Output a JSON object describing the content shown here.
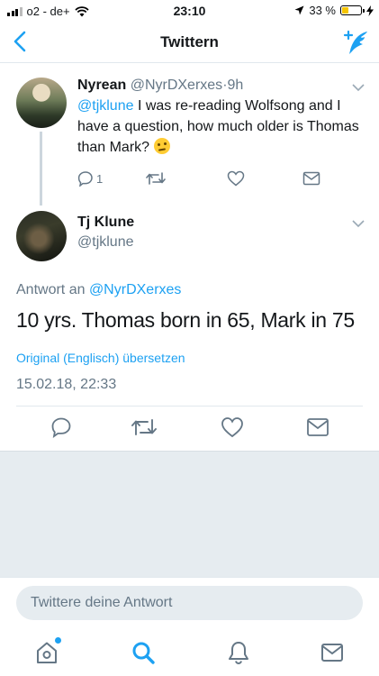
{
  "status_bar": {
    "carrier": "o2 - de+",
    "time": "23:10",
    "battery": "33 %",
    "battery_level": 0.33
  },
  "nav": {
    "title": "Twittern",
    "back_icon": "chevron-left-icon",
    "compose_icon": "compose-tweet-icon"
  },
  "parent_tweet": {
    "name": "Nyrean",
    "handle": "@NyrDXerxes",
    "time": "9h",
    "mention": "@tjklune",
    "text": "I was re-reading Wolfsong and I have a question, how much older is Thomas than Mark?",
    "emoji": "thinking-face-emoji",
    "reply_count": "1"
  },
  "main_tweet": {
    "name": "Tj Klune",
    "handle": "@tjklune",
    "replying_prefix": "Antwort an",
    "replying_to": "@NyrDXerxes",
    "text": "10 yrs. Thomas born in 65, Mark in 75",
    "translate": "Original (Englisch) übersetzen",
    "timestamp": "15.02.18, 22:33"
  },
  "reply": {
    "placeholder": "Twittere deine Antwort"
  },
  "tabbar": {
    "items": [
      "home-icon",
      "search-icon",
      "notifications-icon",
      "messages-icon"
    ],
    "active": "search-icon"
  },
  "colors": {
    "accent": "#1da1f2",
    "muted": "#657786",
    "divider": "#e1e8ed",
    "gray_area": "#e6ecf0",
    "battery": "#f5c400"
  }
}
